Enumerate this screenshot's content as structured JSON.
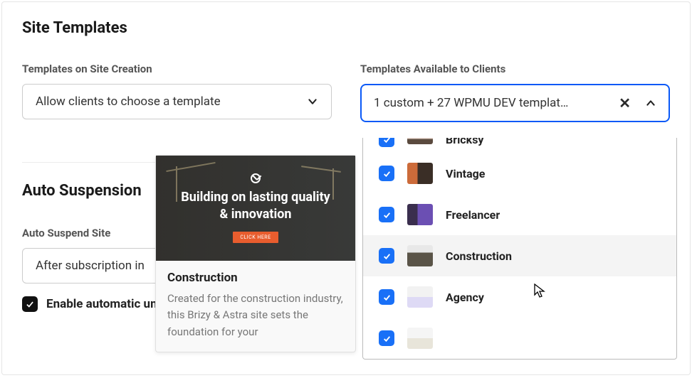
{
  "page": {
    "title": "Site Templates"
  },
  "creation": {
    "label": "Templates on Site Creation",
    "value": "Allow clients to choose a template"
  },
  "available": {
    "label": "Templates Available to Clients",
    "value": "1 custom + 27 WPMU DEV templat…"
  },
  "suspension": {
    "title": "Auto Suspension",
    "suspend_label": "Auto Suspend Site",
    "suspend_value": "After subscription in",
    "enable_text": "Enable automatic unsuspension when the pending in"
  },
  "tooltip": {
    "headline": "Building on lasting quality & innovation",
    "cta": "CLICK HERE",
    "title": "Construction",
    "desc": "Created for the construction industry, this Brizy & Astra site sets the foundation for your"
  },
  "dropdown": {
    "items": [
      {
        "label": "Bricksy",
        "thumb": "th-bricksy",
        "checked": true,
        "highlighted": false
      },
      {
        "label": "Vintage",
        "thumb": "th-vintage",
        "checked": true,
        "highlighted": false
      },
      {
        "label": "Freelancer",
        "thumb": "th-freelancer",
        "checked": true,
        "highlighted": false
      },
      {
        "label": "Construction",
        "thumb": "th-construction",
        "checked": true,
        "highlighted": true
      },
      {
        "label": "Agency",
        "thumb": "th-agency",
        "checked": true,
        "highlighted": false
      },
      {
        "label": "",
        "thumb": "th-last",
        "checked": true,
        "highlighted": false
      }
    ]
  }
}
